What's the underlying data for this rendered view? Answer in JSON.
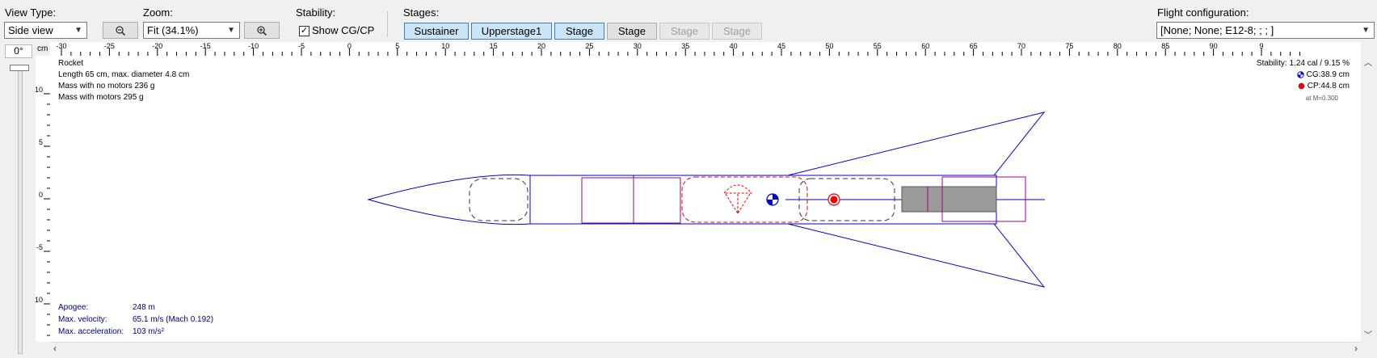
{
  "toolbar": {
    "view_type_label": "View Type:",
    "view_type_value": "Side view",
    "zoom_label": "Zoom:",
    "zoom_value": "Fit (34.1%)",
    "stability_label": "Stability:",
    "show_cgcp_label": "Show CG/CP",
    "show_cgcp_checked": true,
    "stages_label": "Stages:",
    "stages": [
      {
        "label": "Sustainer",
        "state": "selected"
      },
      {
        "label": "Upperstage1",
        "state": "selected"
      },
      {
        "label": "Stage",
        "state": "selected"
      },
      {
        "label": "Stage",
        "state": "normal"
      },
      {
        "label": "Stage",
        "state": "disabled"
      },
      {
        "label": "Stage",
        "state": "disabled"
      }
    ],
    "flight_config_label": "Flight configuration:",
    "flight_config_value": "[None; None; E12-8; ; ; ]"
  },
  "rotation": "0°",
  "ruler": {
    "unit": "cm",
    "h_ticks": [
      "-30",
      "-25",
      "-20",
      "-15",
      "-10",
      "-5",
      "0",
      "5",
      "10",
      "15",
      "20",
      "25",
      "30",
      "35",
      "40",
      "45",
      "50",
      "55",
      "60",
      "65",
      "70",
      "75",
      "80",
      "85",
      "90",
      "9"
    ],
    "v_ticks": [
      "10",
      "5",
      "0",
      "-5",
      "-10"
    ]
  },
  "rocket_info": {
    "name": "Rocket",
    "length": "Length 65 cm, max. diameter 4.8 cm",
    "mass_no_motors": "Mass with no motors 236 g",
    "mass_with_motors": "Mass with motors 295 g"
  },
  "stability_info": {
    "stability": "Stability: 1.24 cal / 9.15 %",
    "cg": "CG:38.9 cm",
    "cp": "CP:44.8 cm",
    "mach": "at M=0.300"
  },
  "flight_data": {
    "apogee_label": "Apogee:",
    "apogee_value": "248 m",
    "velocity_label": "Max. velocity:",
    "velocity_value": "65.1 m/s  (Mach 0.192)",
    "accel_label": "Max. acceleration:",
    "accel_value": "103 m/s²"
  },
  "colors": {
    "structure": "#0000cc",
    "mass_component": "#a0008c",
    "recovery": "#ee0000",
    "motor_fill": "#9a9a9a",
    "selected_stage": "#cce4f7"
  }
}
